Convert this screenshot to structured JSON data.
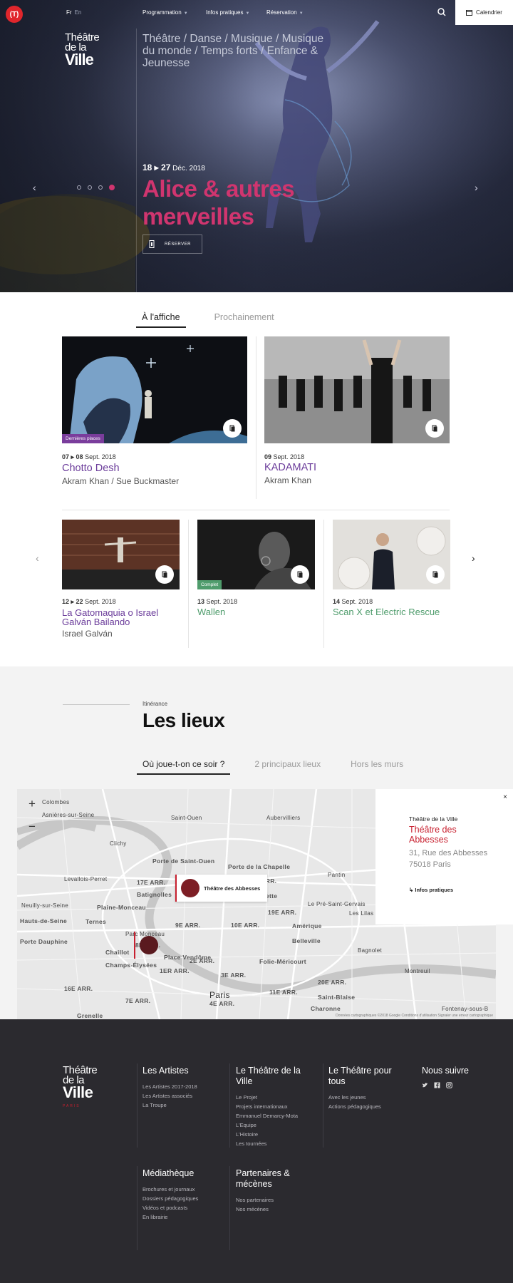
{
  "header": {
    "logo_badge": "(T)",
    "lang_active": "Fr",
    "lang_other": "En",
    "nav": [
      "Programmation",
      "Infos pratiques",
      "Réservation"
    ],
    "calendar_label": "Calendrier",
    "brand": {
      "line1": "Théâtre",
      "line2": "de la",
      "line3": "Ville"
    }
  },
  "hero": {
    "categories": "Théâtre / Danse / Musique / Musique du monde / Temps forts / Enfance & Jeunesse",
    "date_days": "18 ▸ 27",
    "date_month": "Déc. 2018",
    "title": "Alice & autres merveilles",
    "reserve_label": "RÉSERVER",
    "accent": "#d0356f"
  },
  "tabs": {
    "active": "À l'affiche",
    "other": "Prochainement"
  },
  "events_main": [
    {
      "days": "07 ▸ 08",
      "month": "Sept. 2018",
      "title": "Chotto Desh",
      "sub": "Akram Khan / Sue Buckmaster",
      "badge": "Dernières places"
    },
    {
      "days": "09",
      "month": "Sept. 2018",
      "title": "KADAMATI",
      "sub": "Akram Khan",
      "badge": ""
    }
  ],
  "events_small": [
    {
      "days": "12 ▸ 22",
      "month": "Sept. 2018",
      "title": "La Gatomaquia o Israel Galván Bailando",
      "sub": "Israel Galván",
      "badge": ""
    },
    {
      "days": "13",
      "month": "Sept. 2018",
      "title": "Wallen",
      "sub": "",
      "badge": "Complet"
    },
    {
      "days": "14",
      "month": "Sept. 2018",
      "title": "Scan X et Electric Rescue",
      "sub": "",
      "badge": ""
    }
  ],
  "lieux": {
    "kicker": "Itinérance",
    "title": "Les lieux",
    "tabs": [
      "Où joue-t-on ce soir ?",
      "2 principaux lieux",
      "Hors les murs"
    ]
  },
  "map": {
    "pin_label": "Théâtre des Abbesses",
    "labels": [
      "Colombes",
      "Asnières-sur-Seine",
      "Saint-Ouen",
      "Aubervilliers",
      "Clichy",
      "Levallois-Perret",
      "Porte de Saint-Ouen",
      "Porte de la Chapelle",
      "17E ARR.",
      "18E ARR.",
      "Pantin",
      "Batignolles",
      "La Villette",
      "Neuilly-sur-Seine",
      "Plaine-Monceau",
      "19E ARR.",
      "Le Pré-Saint-Gervais",
      "Ternes",
      "9E ARR.",
      "10E ARR.",
      "Les Lilas",
      "Hauts-de-Seine",
      "Porte Dauphine",
      "Parc Monceau",
      "Amérique",
      "Chaillot",
      "8E ARR.",
      "Belleville",
      "Bagnolet",
      "Champs-Élysées",
      "Place Vendôme",
      "2E ARR.",
      "Folie-Méricourt",
      "1ER ARR.",
      "3E ARR.",
      "16E ARR.",
      "Paris",
      "11E ARR.",
      "20E ARR.",
      "Montreuil",
      "7E ARR.",
      "4E ARR.",
      "Saint-Blaise",
      "Grenelle",
      "Charonne",
      "Fontenay-sous-B"
    ],
    "footer": "Données cartographiques ©2018 Google   Conditions d'utilisation   Signaler une erreur cartographique"
  },
  "venue": {
    "line1": "Théâtre de la Ville",
    "name": "Théâtre des Abbesses",
    "address": "31, Rue des Abbesses 75018 Paris",
    "link": "Infos pratiques",
    "close": "×"
  },
  "footer": {
    "brand_paris": "PARIS",
    "columns": [
      {
        "title": "Les Artistes",
        "items": [
          "Les Artistes 2017-2018",
          "Les Artistes associés",
          "La Troupe"
        ]
      },
      {
        "title": "Le Théâtre de la Ville",
        "items": [
          "Le Projet",
          "Projets internationaux",
          "Emmanuel Demarcy-Mota",
          "L'Equipe",
          "L'Histoire",
          "Les tournées"
        ]
      },
      {
        "title": "Le Théâtre pour tous",
        "items": [
          "Avec les jeunes",
          "Actions pédagogiques"
        ]
      },
      {
        "title": "Nous suivre",
        "items": []
      },
      {
        "title": "Médiathèque",
        "items": [
          "Brochures et journaux",
          "Dossiers pédagogiques",
          "Vidéos et podcasts",
          "En librairie"
        ]
      },
      {
        "title": "Partenaires & mécènes",
        "items": [
          "Nos partenaires",
          "Nos mécènes"
        ]
      }
    ]
  },
  "colors": {
    "purple": "#6a3b9a",
    "green": "#4f9c6c",
    "red": "#c8202f",
    "footer_bg": "#2b2a2f"
  }
}
